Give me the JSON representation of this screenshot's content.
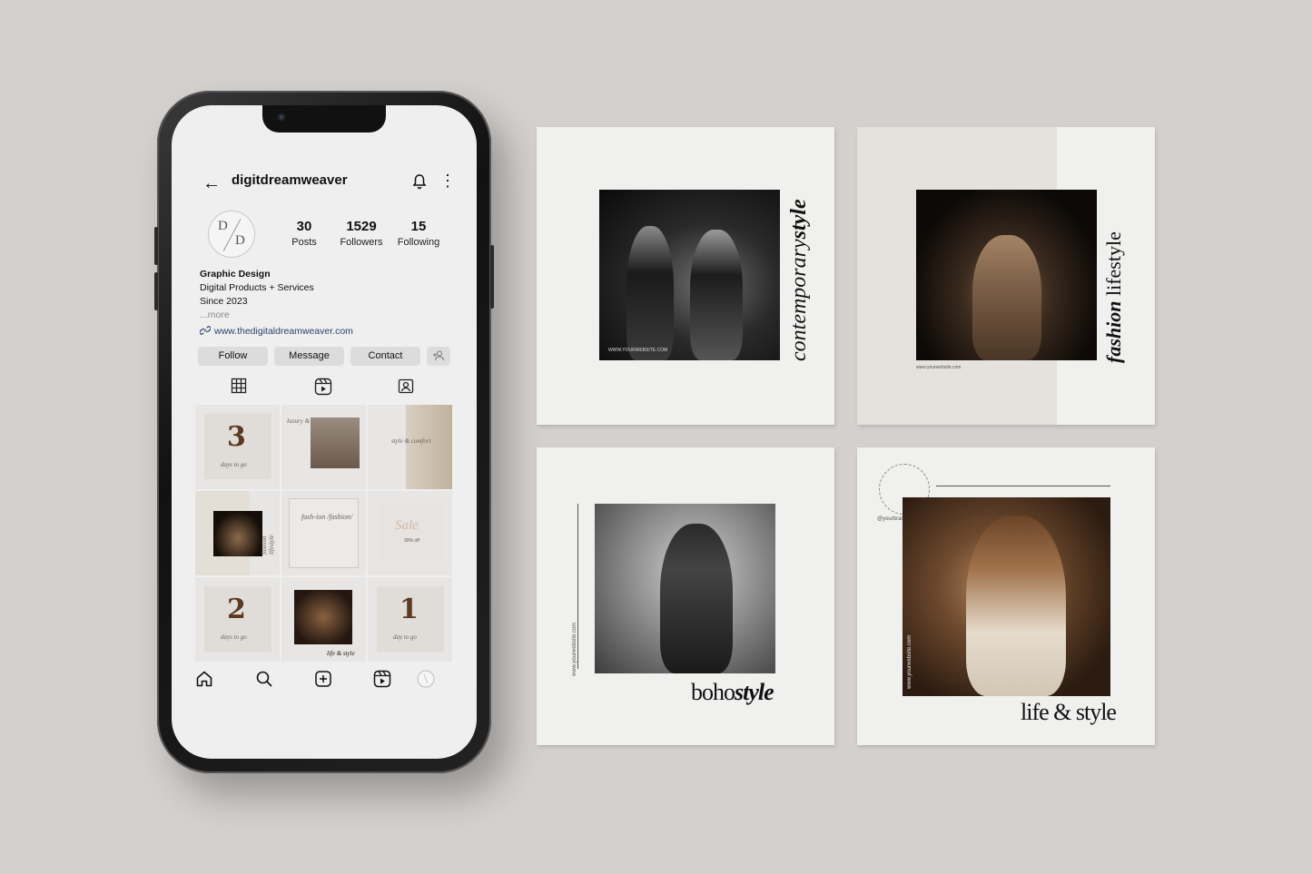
{
  "profile": {
    "username": "digitdreamweaver",
    "avatar": {
      "letter1": "D",
      "letter2": "D"
    },
    "stats": [
      {
        "value": "30",
        "label": "Posts"
      },
      {
        "value": "1529",
        "label": "Followers"
      },
      {
        "value": "15",
        "label": "Following"
      }
    ],
    "bio": {
      "title": "Graphic Design",
      "line1": "Digital Products + Services",
      "line2": "Since 2023",
      "more": "...more"
    },
    "link": "www.thedigitaldreamweaver.com",
    "buttons": {
      "follow": "Follow",
      "message": "Message",
      "contact": "Contact"
    }
  },
  "grid_posts": [
    {
      "big": "3",
      "script": "days to go"
    },
    {
      "script": "luxury & style"
    },
    {
      "script": "style & comfort"
    },
    {
      "script": "fashion lifestyle"
    },
    {
      "script": "fash-ion /fashion/"
    },
    {
      "script": "Sale",
      "sub": "30% off"
    },
    {
      "big": "2",
      "script": "days to go"
    },
    {
      "script": "life & style"
    },
    {
      "big": "1",
      "script": "day to go"
    }
  ],
  "cards": {
    "contemporary": {
      "title_a": "contemporary",
      "title_b": "style",
      "url": "WWW.YOURWEBSITE.COM"
    },
    "fashion": {
      "title_a": "fashion",
      "title_b": "lifestyle",
      "url": "www.yourwebsite.com"
    },
    "boho": {
      "title_a": "boho",
      "title_b": "style",
      "url": "www.yourwebsite.com"
    },
    "life": {
      "title": "life & style",
      "url": "www.yourwebsite.com",
      "circle_text": "@yourbrandname"
    }
  },
  "colors": {
    "background": "#d4d0cd",
    "phone": "#111111",
    "screen": "#efefef",
    "card": "#f0f0ef",
    "accent_brown": "#5c3a22",
    "link": "#2a3f6e"
  }
}
